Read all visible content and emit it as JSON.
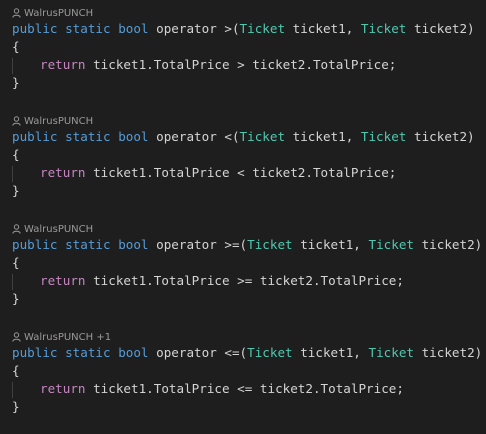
{
  "colors": {
    "background": "#1e1e1e",
    "text": "#d4d4d4",
    "keyword": "#569cd6",
    "control_keyword": "#c586c0",
    "type": "#4ec9b0",
    "codelens": "#999999"
  },
  "blocks": [
    {
      "author_icon": "person-icon",
      "author": "WalrusPUNCH",
      "kw_public": "public",
      "kw_static": "static",
      "kw_bool": "bool",
      "signature_pre": "operator >(",
      "type1": "Ticket",
      "param1": "ticket1,",
      "type2": "Ticket",
      "param2": "ticket2)",
      "open_brace": "{",
      "kw_return": "return",
      "body": "ticket1.TotalPrice > ticket2.TotalPrice;",
      "close_brace": "}"
    },
    {
      "author_icon": "person-icon",
      "author": "WalrusPUNCH",
      "kw_public": "public",
      "kw_static": "static",
      "kw_bool": "bool",
      "signature_pre": "operator <(",
      "type1": "Ticket",
      "param1": "ticket1,",
      "type2": "Ticket",
      "param2": "ticket2)",
      "open_brace": "{",
      "kw_return": "return",
      "body": "ticket1.TotalPrice < ticket2.TotalPrice;",
      "close_brace": "}"
    },
    {
      "author_icon": "person-icon",
      "author": "WalrusPUNCH",
      "kw_public": "public",
      "kw_static": "static",
      "kw_bool": "bool",
      "signature_pre": "operator >=(",
      "type1": "Ticket",
      "param1": "ticket1,",
      "type2": "Ticket",
      "param2": "ticket2)",
      "open_brace": "{",
      "kw_return": "return",
      "body": "ticket1.TotalPrice >= ticket2.TotalPrice;",
      "close_brace": "}"
    },
    {
      "author_icon": "person-icon",
      "author": "WalrusPUNCH +1",
      "kw_public": "public",
      "kw_static": "static",
      "kw_bool": "bool",
      "signature_pre": "operator <=(",
      "type1": "Ticket",
      "param1": "ticket1,",
      "type2": "Ticket",
      "param2": "ticket2)",
      "open_brace": "{",
      "kw_return": "return",
      "body": "ticket1.TotalPrice <= ticket2.TotalPrice;",
      "close_brace": "}"
    }
  ]
}
